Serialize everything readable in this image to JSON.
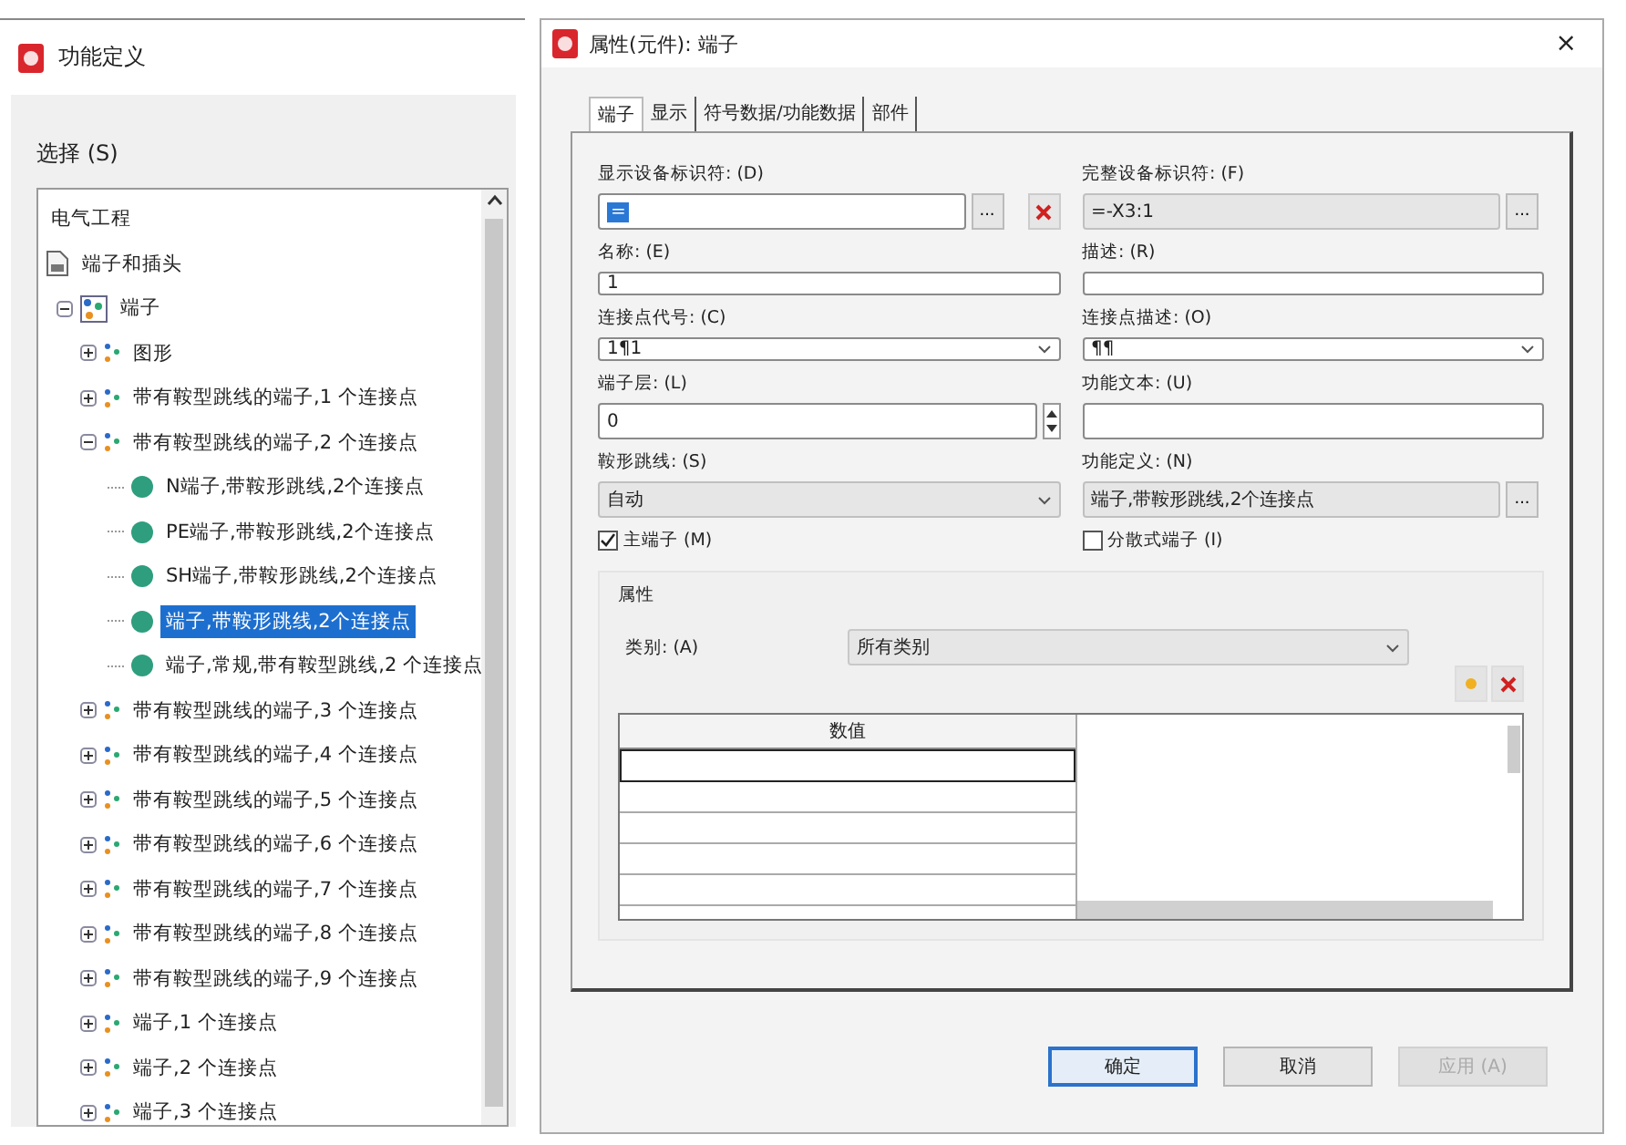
{
  "function_window": {
    "title": "功能定义",
    "tree_label": "选择 (S)",
    "tree": [
      {
        "label": "电气工程",
        "kind": "text",
        "selected": false
      },
      {
        "label": "端子和插头",
        "kind": "library",
        "selected": false
      },
      {
        "label": "端子",
        "kind": "category",
        "expanded": true,
        "selected": false,
        "children": [
          {
            "label": "图形",
            "kind": "group",
            "expanded": false,
            "selected": false
          },
          {
            "label": "带有鞍型跳线的端子,1 个连接点",
            "kind": "group",
            "expanded": false,
            "selected": false
          },
          {
            "label": "带有鞍型跳线的端子,2 个连接点",
            "kind": "group",
            "expanded": true,
            "selected": false,
            "children": [
              {
                "label": "N端子,带鞍形跳线,2个连接点",
                "kind": "variant",
                "selected": false
              },
              {
                "label": "PE端子,带鞍形跳线,2个连接点",
                "kind": "variant",
                "selected": false
              },
              {
                "label": "SH端子,带鞍形跳线,2个连接点",
                "kind": "variant",
                "selected": false
              },
              {
                "label": "端子,带鞍形跳线,2个连接点",
                "kind": "variant",
                "selected": true
              },
              {
                "label": "端子,常规,带有鞍型跳线,2 个连接点",
                "kind": "variant",
                "selected": false
              }
            ]
          },
          {
            "label": "带有鞍型跳线的端子,3 个连接点",
            "kind": "group",
            "expanded": false,
            "selected": false
          },
          {
            "label": "带有鞍型跳线的端子,4 个连接点",
            "kind": "group",
            "expanded": false,
            "selected": false
          },
          {
            "label": "带有鞍型跳线的端子,5 个连接点",
            "kind": "group",
            "expanded": false,
            "selected": false
          },
          {
            "label": "带有鞍型跳线的端子,6 个连接点",
            "kind": "group",
            "expanded": false,
            "selected": false
          },
          {
            "label": "带有鞍型跳线的端子,7 个连接点",
            "kind": "group",
            "expanded": false,
            "selected": false
          },
          {
            "label": "带有鞍型跳线的端子,8 个连接点",
            "kind": "group",
            "expanded": false,
            "selected": false
          },
          {
            "label": "带有鞍型跳线的端子,9 个连接点",
            "kind": "group",
            "expanded": false,
            "selected": false
          },
          {
            "label": "端子,1 个连接点",
            "kind": "group",
            "expanded": false,
            "selected": false
          },
          {
            "label": "端子,2 个连接点",
            "kind": "group",
            "expanded": false,
            "selected": false
          },
          {
            "label": "端子,3 个连接点",
            "kind": "group",
            "expanded": false,
            "selected": false
          }
        ]
      }
    ]
  },
  "dialog": {
    "title": "属性(元件): 端子",
    "close": "×",
    "tabs": [
      {
        "label": "端子",
        "selected": true
      },
      {
        "label": "显示",
        "selected": false
      },
      {
        "label": "符号数据/功能数据",
        "selected": false
      },
      {
        "label": "部件",
        "selected": false
      }
    ],
    "fields": [
      {
        "kind": "browse",
        "label": "显示设备标识符: (D)",
        "value": "=",
        "value_selected": true,
        "button": "...",
        "clear": true,
        "disabled": false
      },
      {
        "kind": "browse",
        "label": "完整设备标识符: (F)",
        "value": "=-X3:1",
        "value_selected": false,
        "button": "...",
        "disabled": true
      },
      {
        "kind": "text",
        "label": "名称: (E)",
        "value": "1",
        "disabled": false
      },
      {
        "kind": "text",
        "label": "描述: (R)",
        "disabled": false
      },
      {
        "kind": "select",
        "label": "连接点代号: (C)",
        "value": "1¶1",
        "disabled": false
      },
      {
        "kind": "select",
        "label": "连接点描述: (O)",
        "value": "¶¶",
        "disabled": false
      },
      {
        "kind": "spin",
        "label": "端子层: (L)",
        "value": "0",
        "disabled": false
      },
      {
        "kind": "text",
        "label": "功能文本: (U)",
        "disabled": false
      },
      {
        "kind": "select",
        "label": "鞍形跳线: (S)",
        "value": "自动",
        "disabled": true
      },
      {
        "kind": "browse",
        "label": "功能定义: (N)",
        "value": "端子,带鞍形跳线,2个连接点",
        "value_selected": false,
        "button": "...",
        "disabled": true
      },
      {
        "kind": "check",
        "label": "主端子 (M)",
        "checked": true
      },
      {
        "kind": "check",
        "label": "分散式端子 (I)",
        "checked": false
      }
    ],
    "properties": {
      "title": "属性",
      "category_label": "类别: (A)",
      "category_value": "所有类别",
      "column": "数值"
    },
    "buttons": [
      {
        "label": "确定",
        "default": true,
        "disabled": false
      },
      {
        "label": "取消",
        "default": false,
        "disabled": false
      },
      {
        "label": "应用 (A)",
        "default": false,
        "disabled": true
      }
    ]
  }
}
